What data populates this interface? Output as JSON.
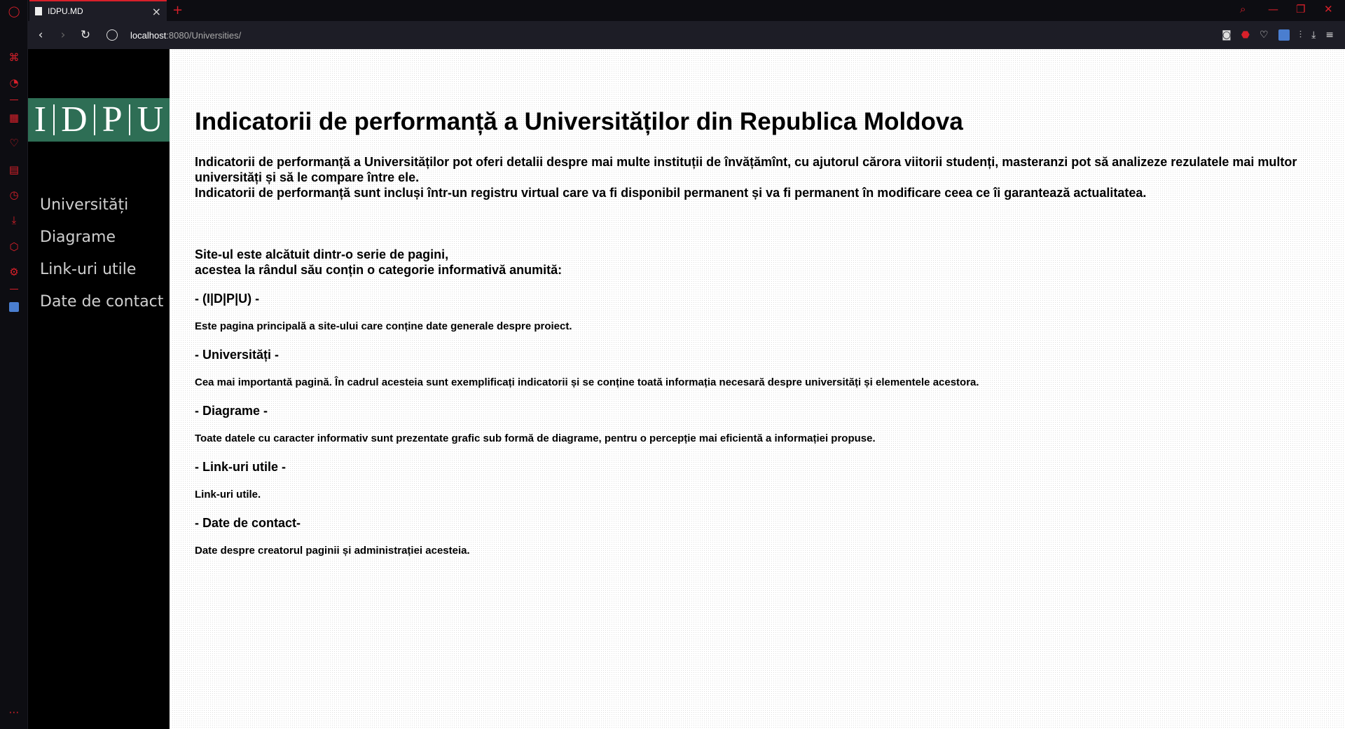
{
  "browser": {
    "tab_title": "IDPU.MD",
    "url_host": "localhost",
    "url_path": ":8080/Universities/"
  },
  "site": {
    "logo_letters": [
      "I",
      "D",
      "P",
      "U"
    ],
    "menu": [
      "Universități",
      "Diagrame",
      "Link-uri utile",
      "Date de contact"
    ]
  },
  "content": {
    "title": "Indicatorii de performanță a Universităților din Republica Moldova",
    "intro_line1": "Indicatorii de performanță a Universităților pot oferi detalii despre mai multe instituții de învățămînt, cu ajutorul cărora viitorii studenți, masteranzi pot să analizeze rezulatele mai multor universități și să le compare între ele.",
    "intro_line2": "Indicatorii de performanță sunt incluși într-un registru virtual care va fi disponibil permanent și va fi permanent în modificare ceea ce îi garantează actualitatea.",
    "structure_line1": "Site-ul este alcătuit dintr-o serie de pagini,",
    "structure_line2": "acestea la rândul său conțin o categorie informativă anumită:",
    "sections": [
      {
        "heading": "- (I|D|P|U) -",
        "text": "Este pagina principală a site-ului care conține date generale despre proiect."
      },
      {
        "heading": "- Universități -",
        "text": "Cea mai importantă pagină. În cadrul acesteia sunt exemplificați indicatorii și se conține toată informația necesară despre universități și elementele acestora."
      },
      {
        "heading": "- Diagrame -",
        "text": "Toate datele cu caracter informativ sunt prezentate grafic sub formă de diagrame, pentru o percepție mai eficientă a informației propuse."
      },
      {
        "heading": "- Link-uri utile -",
        "text": "Link-uri utile."
      },
      {
        "heading": "- Date de contact-",
        "text": "Date despre creatorul paginii și administrației acesteia."
      }
    ]
  },
  "colors": {
    "browser_accent": "#d8202a",
    "logo_green": "#2e6e55",
    "sidebar_bg": "#000000"
  },
  "icons": {
    "rail": [
      "opera-logo-icon",
      "game-controller-icon",
      "speed-dial-icon",
      "grid-icon",
      "heart-icon",
      "news-icon",
      "history-icon",
      "download-icon",
      "cube-icon",
      "settings-icon",
      "extension-icon",
      "more-icon"
    ],
    "toolbar": [
      "camera-icon",
      "shield-icon",
      "heart-icon",
      "extension-icon",
      "equalizer-icon",
      "download-icon",
      "menu-icon"
    ]
  }
}
